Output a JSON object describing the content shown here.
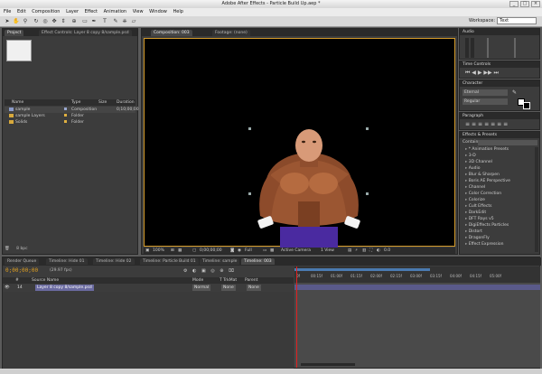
{
  "window": {
    "title": "Adobe After Effects - Particle Build Up.aep *"
  },
  "menu": [
    "File",
    "Edit",
    "Composition",
    "Layer",
    "Effect",
    "Animation",
    "View",
    "Window",
    "Help"
  ],
  "workspace": {
    "label": "Workspace:",
    "value": "Text"
  },
  "project_panel": {
    "tabs": [
      "Project",
      "Effect Controls: Layer 8 copy 8/sample.psd"
    ],
    "columns": [
      "Name",
      "Type",
      "Size",
      "Duration"
    ],
    "rows": [
      {
        "name": "sample",
        "type": "Composition",
        "size": "",
        "duration": "0;10;00;00",
        "kind": "comp"
      },
      {
        "name": "sample Layers",
        "type": "Folder",
        "size": "",
        "duration": "",
        "kind": "folder"
      },
      {
        "name": "Solids",
        "type": "Folder",
        "size": "",
        "duration": "",
        "kind": "folder"
      }
    ],
    "footer": "8 bpc"
  },
  "comp_panel": {
    "tabs": [
      "Composition: 003",
      "Footage: (none)"
    ],
    "bar": {
      "zoom": "100%",
      "time": "0;00;00;00",
      "resolution": "Full",
      "camera": "Active Camera",
      "views": "1 View"
    }
  },
  "right_panels": {
    "audio": "Audio",
    "time_controls": "Time Controls",
    "character": {
      "title": "Character",
      "font": "Eternal",
      "style": "Regular"
    },
    "paragraph": "Paragraph",
    "effects": {
      "title": "Effects & Presets",
      "contains_label": "Contains:",
      "items": [
        "* Animation Presets",
        "3-D",
        "3D Channel",
        "Audio",
        "Blur & Sharpen",
        "Boris AE Perspective",
        "Channel",
        "Color Correction",
        "Colorize",
        "Cult Effects",
        "DarkEdit",
        "DFT Rays v5",
        "DigiEffects Particles",
        "Distort",
        "DragonFly",
        "Effect Expression"
      ]
    }
  },
  "timeline": {
    "tabs": [
      "Render Queue",
      "Timeline: Hide 01",
      "Timeline: Hide 02",
      "Timeline: Particle Build 01",
      "Timeline: sample",
      "Timeline: 003"
    ],
    "current_time": "0;00;00;00",
    "fps": "(29.97 fps)",
    "columns": [
      "#",
      "Source Name",
      "Mode",
      "T TrkMat",
      "Parent"
    ],
    "layer": {
      "index": "14",
      "name": "Layer 8 copy 8/sample.psd",
      "mode": "Normal",
      "trkmat": "None",
      "parent": "None"
    },
    "ruler": [
      "0f",
      "00:15f",
      "01:00f",
      "01:15f",
      "02:00f",
      "02:15f",
      "03:00f",
      "03:15f",
      "04:00f",
      "04:15f",
      "05:00f"
    ]
  }
}
